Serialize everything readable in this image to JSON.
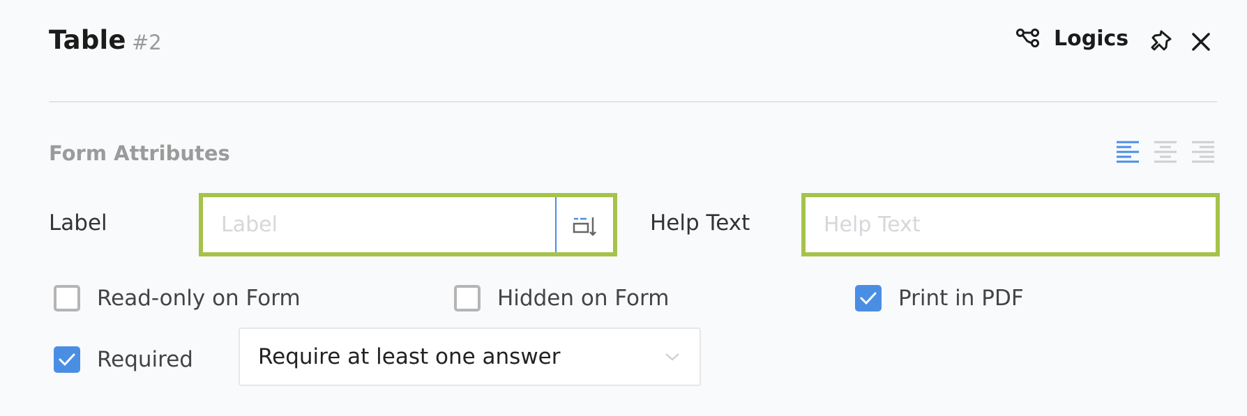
{
  "header": {
    "title": "Table",
    "title_number": "#2",
    "logics_label": "Logics",
    "icons": {
      "logics": "logic-graph-icon",
      "pin": "pin-icon",
      "close": "close-icon"
    }
  },
  "form_attributes": {
    "section_title": "Form Attributes",
    "alignment": {
      "options": [
        "left",
        "center",
        "right"
      ],
      "selected": "left",
      "active_color": "#4a8ee4",
      "inactive_color": "#cfcfcf"
    },
    "label_field": {
      "label": "Label",
      "value": "",
      "placeholder": "Label",
      "icon": "insert-field-icon"
    },
    "help_text_field": {
      "label": "Help Text",
      "value": "",
      "placeholder": "Help Text"
    },
    "checkboxes": [
      {
        "label": "Read-only on Form",
        "checked": false
      },
      {
        "label": "Hidden on Form",
        "checked": false
      },
      {
        "label": "Print in PDF",
        "checked": true
      },
      {
        "label": "Required",
        "checked": true
      }
    ],
    "required_rule": {
      "selected": "Require at least one answer"
    },
    "colors": {
      "highlight_border": "#a5c34a",
      "checkbox_checked": "#4a8ee4"
    }
  }
}
